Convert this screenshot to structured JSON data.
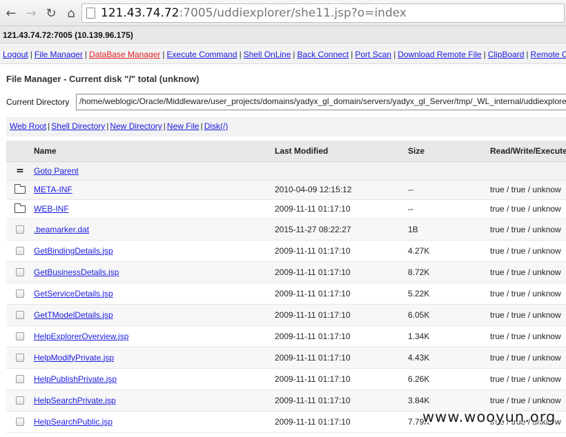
{
  "browser": {
    "url_host": "121.43.74.72",
    "url_rest": ":7005/uddiexplorer/she11.jsp?o=index"
  },
  "header": {
    "host_info": "121.43.74.72:7005 (10.139.96.175)"
  },
  "menu": [
    {
      "label": "Logout",
      "active": false
    },
    {
      "label": "File Manager",
      "active": false
    },
    {
      "label": "DataBase Manager",
      "active": true
    },
    {
      "label": "Execute Command",
      "active": false
    },
    {
      "label": "Shell OnLine",
      "active": false
    },
    {
      "label": "Back Connect",
      "active": false
    },
    {
      "label": "Port Scan",
      "active": false
    },
    {
      "label": "Download Remote File",
      "active": false
    },
    {
      "label": "ClipBoard",
      "active": false
    },
    {
      "label": "Remote Control",
      "active": false
    }
  ],
  "file_manager": {
    "title": "File Manager - Current disk \"/\" total (unknow)",
    "current_dir_label": "Current Directory",
    "current_dir_value": "/home/weblogic/Oracle/Middleware/user_projects/domains/yadyx_gl_domain/servers/yadyx_gl_Server/tmp/_WL_internal/uddiexplorer",
    "quick_links": [
      "Web Root",
      "Shell Directory",
      "New Directory",
      "New File",
      "Disk(/)"
    ]
  },
  "table": {
    "columns": {
      "name": "Name",
      "modified": "Last Modified",
      "size": "Size",
      "rwx": "Read/Write/Execute"
    },
    "parent": {
      "icon": "=",
      "label": "Goto Parent"
    },
    "rows": [
      {
        "type": "dir",
        "name": "META-INF",
        "modified": "2010-04-09 12:15:12",
        "size": "--",
        "rwx": "true / true / unknow"
      },
      {
        "type": "dir",
        "name": "WEB-INF",
        "modified": "2009-11-11 01:17:10",
        "size": "--",
        "rwx": "true / true / unknow"
      },
      {
        "type": "file",
        "name": ".beamarker.dat",
        "modified": "2015-11-27 08:22:27",
        "size": "1B",
        "rwx": "true / true / unknow"
      },
      {
        "type": "file",
        "name": "GetBindingDetails.jsp",
        "modified": "2009-11-11 01:17:10",
        "size": "4.27K",
        "rwx": "true / true / unknow"
      },
      {
        "type": "file",
        "name": "GetBusinessDetails.jsp",
        "modified": "2009-11-11 01:17:10",
        "size": "8.72K",
        "rwx": "true / true / unknow"
      },
      {
        "type": "file",
        "name": "GetServiceDetails.jsp",
        "modified": "2009-11-11 01:17:10",
        "size": "5.22K",
        "rwx": "true / true / unknow"
      },
      {
        "type": "file",
        "name": "GetTModelDetails.jsp",
        "modified": "2009-11-11 01:17:10",
        "size": "6.05K",
        "rwx": "true / true / unknow"
      },
      {
        "type": "file",
        "name": "HelpExplorerOverview.jsp",
        "modified": "2009-11-11 01:17:10",
        "size": "1.34K",
        "rwx": "true / true / unknow"
      },
      {
        "type": "file",
        "name": "HelpModifyPrivate.jsp",
        "modified": "2009-11-11 01:17:10",
        "size": "4.43K",
        "rwx": "true / true / unknow"
      },
      {
        "type": "file",
        "name": "HelpPublishPrivate.jsp",
        "modified": "2009-11-11 01:17:10",
        "size": "6.26K",
        "rwx": "true / true / unknow"
      },
      {
        "type": "file",
        "name": "HelpSearchPrivate.jsp",
        "modified": "2009-11-11 01:17:10",
        "size": "3.84K",
        "rwx": "true / true / unknow"
      },
      {
        "type": "file",
        "name": "HelpSearchPublic.jsp",
        "modified": "2009-11-11 01:17:10",
        "size": "7.79K",
        "rwx": "true / true / unknow"
      }
    ]
  },
  "watermark": "www.wooyun.org",
  "colors": {
    "link": "#1a1ae0",
    "active_menu": "#e02020",
    "header_bg": "#e8e8e8"
  }
}
